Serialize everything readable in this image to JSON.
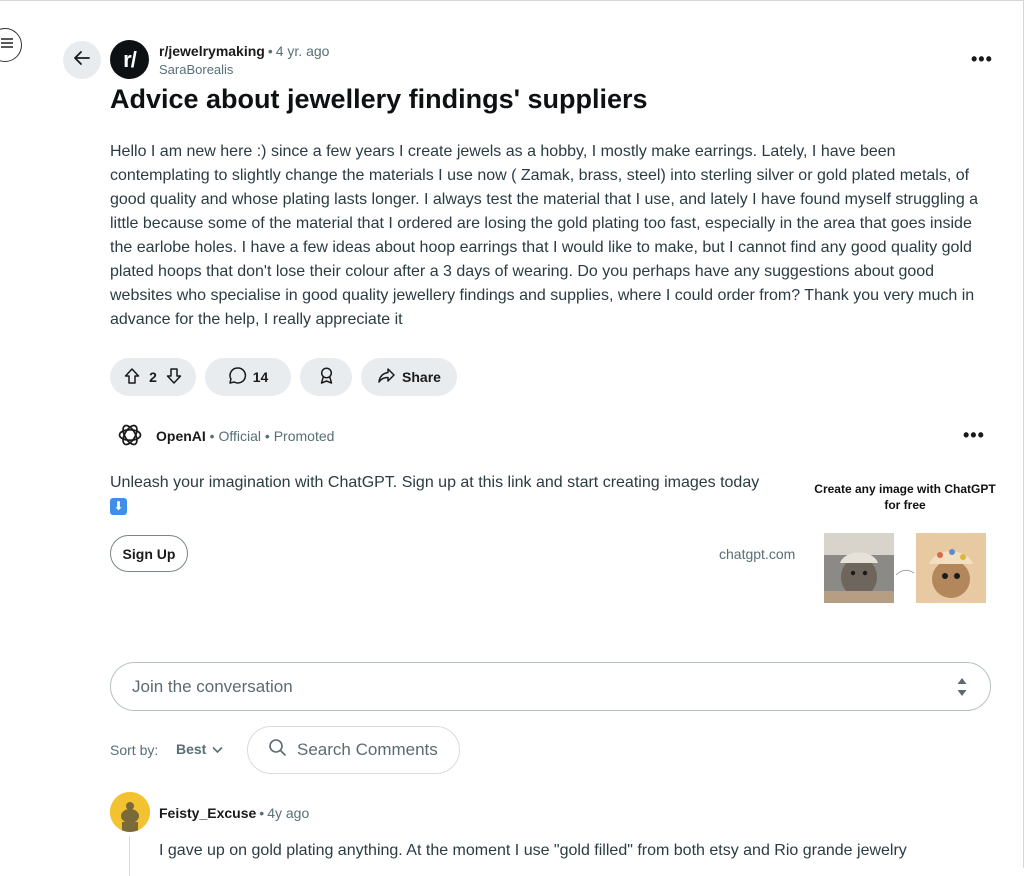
{
  "post": {
    "subreddit": "r/jewelrymaking",
    "avatar_text": "r/",
    "age": "4 yr. ago",
    "author": "SaraBorealis",
    "title": "Advice about jewellery findings' suppliers",
    "body": "Hello I am new here :) since a few years I create jewels as a hobby, I mostly make earrings. Lately, I have been contemplating to slightly change the materials I use now ( Zamak, brass, steel) into sterling silver or gold plated metals, of good quality and whose plating lasts longer. I always test the material that I use, and lately I have found myself struggling a little because some of the material that I ordered are losing the gold plating too fast, especially in the area that goes inside the earlobe holes. I have a few ideas about hoop earrings that I would like to make, but I cannot find any good quality gold plated hoops that don't lose their colour after a 3 days of wearing. Do you perhaps have any suggestions about good websites who specialise in good quality jewellery findings and supplies, where I could order from? Thank you very much in advance for the help, I really appreciate it",
    "votes": "2",
    "comments": "14",
    "share_label": "Share"
  },
  "promo": {
    "advertiser": "OpenAI",
    "official": "Official",
    "promoted": "Promoted",
    "text": "Unleash your imagination with ChatGPT. Sign up at this link and start creating images today",
    "emoji": "⬇",
    "cta": "Sign Up",
    "domain": "chatgpt.com",
    "image_caption": "Create any image with ChatGPT for free"
  },
  "comment_box": {
    "placeholder": "Join the conversation"
  },
  "sort": {
    "label": "Sort by:",
    "value": "Best"
  },
  "search": {
    "placeholder": "Search Comments"
  },
  "first_comment": {
    "user": "Feisty_Excuse",
    "age": "4y ago",
    "text": "I gave up on gold plating anything. At the moment I use \"gold filled\" from both etsy and Rio grande jewelry"
  },
  "icons": {
    "menu": "menu-icon",
    "back": "arrow-left-icon",
    "overflow": "more-horizontal-icon",
    "upvote": "arrow-up-icon",
    "downvote": "arrow-down-icon",
    "comment": "comment-bubble-icon",
    "award": "award-icon",
    "share": "share-arrow-icon",
    "openai": "openai-logo",
    "resize": "resize-handle-icon",
    "sort_chevron": "chevron-down-icon",
    "search": "search-icon"
  },
  "colors": {
    "pill_bg": "#e9ecee",
    "text_primary": "#1a1a1b",
    "text_muted": "#576f76",
    "snoo_yellow": "#f2c230"
  }
}
